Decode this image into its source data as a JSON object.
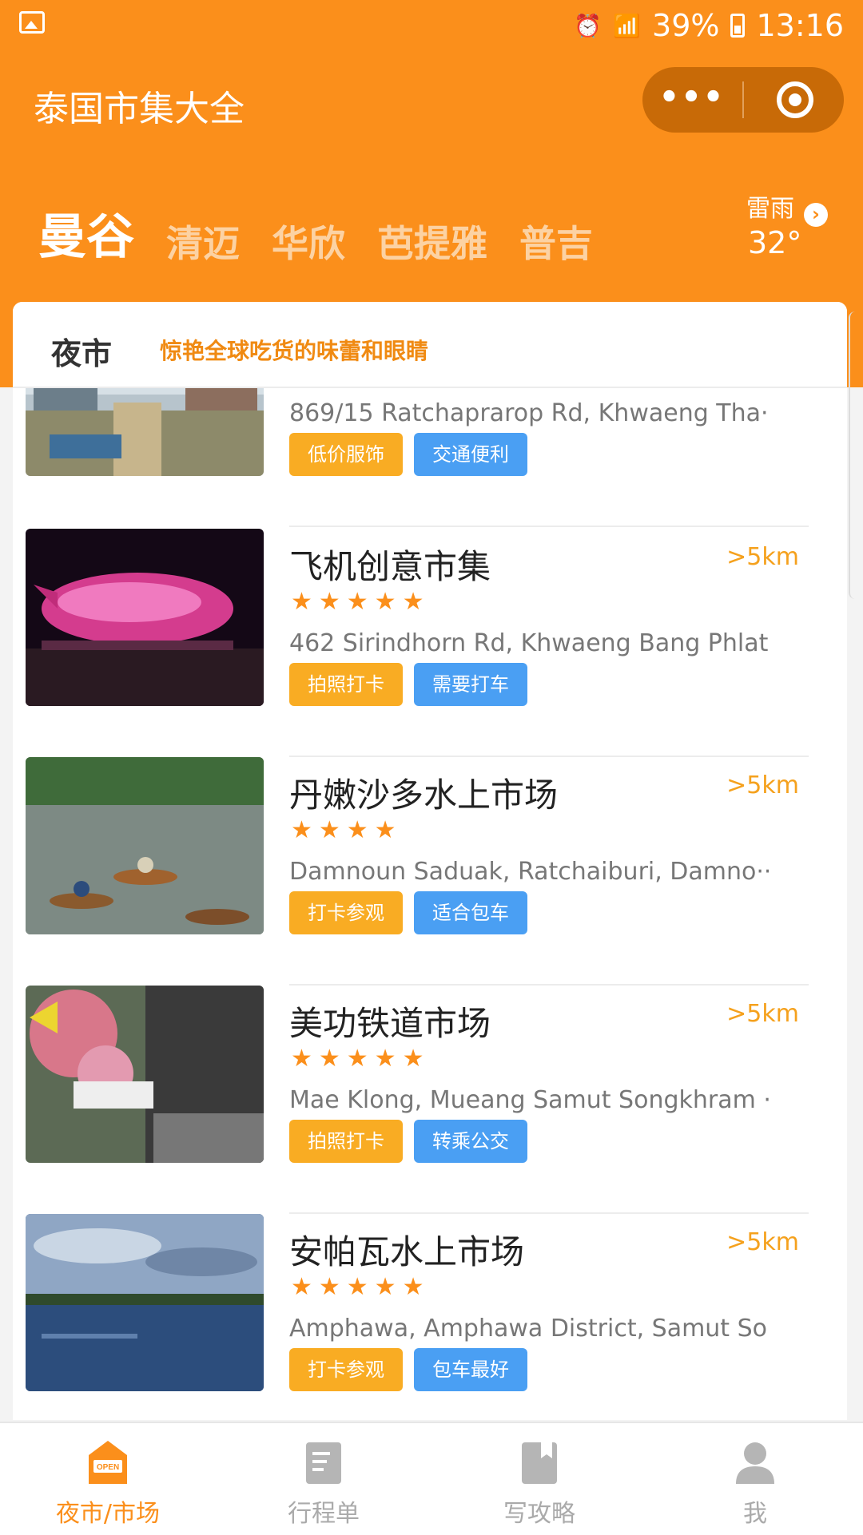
{
  "status_bar": {
    "battery": "39%",
    "time": "13:16"
  },
  "app": {
    "title": "泰国市集大全",
    "capsule_more": "•••"
  },
  "cities": [
    "曼谷",
    "清迈",
    "华欣",
    "芭提雅",
    "普吉"
  ],
  "weather": {
    "condition": "雷雨",
    "temperature": "32°"
  },
  "section": {
    "title": "夜市",
    "slogan": "惊艳全球吃货的味蕾和眼睛"
  },
  "items": [
    {
      "name": "",
      "address": "869/15 Ratchaprarop Rd, Khwaeng Tha···",
      "tags": [
        "低价服饰",
        "交通便利"
      ],
      "rating": 0,
      "distance": ""
    },
    {
      "name": "飞机创意市集",
      "distance": ">5km",
      "stars": "★★★★★",
      "rating": 5,
      "address": "462 Sirindhorn Rd, Khwaeng Bang Phlat···",
      "tags": [
        "拍照打卡",
        "需要打车"
      ]
    },
    {
      "name": "丹嫩沙多水上市场",
      "distance": ">5km",
      "stars": "★★★★",
      "rating": 4,
      "address": "Damnoun Saduak, Ratchaiburi, Damno···",
      "tags": [
        "打卡参观",
        "适合包车"
      ]
    },
    {
      "name": "美功铁道市场",
      "distance": ">5km",
      "stars": "★★★★★",
      "rating": 5,
      "address": "Mae Klong, Mueang Samut Songkhram ···",
      "tags": [
        "拍照打卡",
        "转乘公交"
      ]
    },
    {
      "name": "安帕瓦水上市场",
      "distance": ">5km",
      "stars": "★★★★★",
      "rating": 5,
      "address": "Amphawa, Amphawa District, Samut So···",
      "tags": [
        "打卡参观",
        "包车最好"
      ]
    }
  ],
  "nav": {
    "items": [
      {
        "label": "夜市/市场",
        "icon": "open-shop-icon",
        "active": true,
        "badge": "OPEN"
      },
      {
        "label": "行程单",
        "icon": "document-icon",
        "active": false
      },
      {
        "label": "写攻略",
        "icon": "bookmark-book-icon",
        "active": false
      },
      {
        "label": "我",
        "icon": "user-icon",
        "active": false
      }
    ]
  },
  "colors": {
    "primary": "#fb8f1b",
    "tag_orange": "#f9ac23",
    "tag_blue": "#4a9ff3",
    "distance": "#f5a11d"
  }
}
